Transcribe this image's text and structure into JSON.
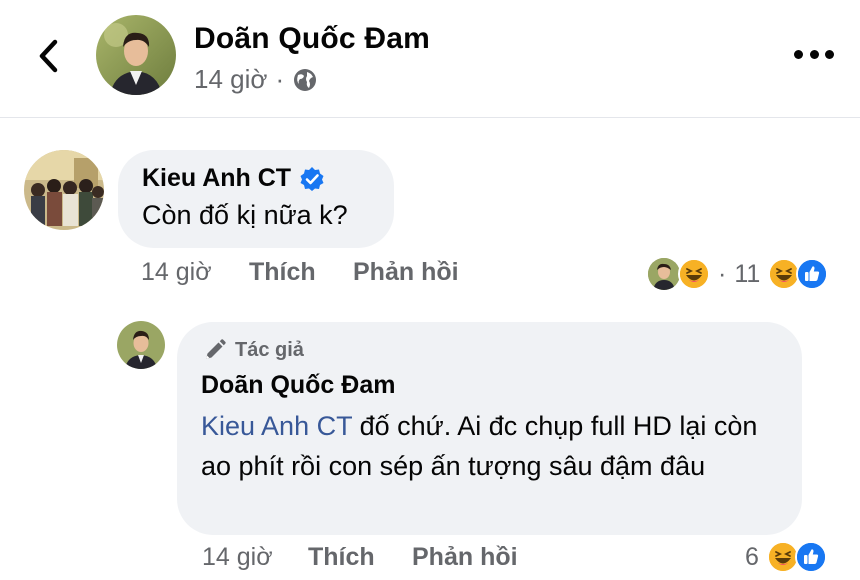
{
  "header": {
    "name": "Doãn Quốc Đam",
    "time": "14 giờ",
    "separator": "·"
  },
  "comments": [
    {
      "author": "Kieu Anh CT",
      "verified": true,
      "text": "Còn đố kị nữa k?",
      "time": "14 giờ",
      "like_label": "Thích",
      "reply_label": "Phản hồi",
      "reaction_separator": "·",
      "reaction_count": "11"
    },
    {
      "author_badge": "Tác giả",
      "author": "Doãn Quốc Đam",
      "mention": "Kieu Anh CT",
      "text": " đố chứ. Ai đc chụp full HD lại còn ao phít rồi con sép ấn tượng sâu đậm đâu",
      "time": "14 giờ",
      "like_label": "Thích",
      "reply_label": "Phản hồi",
      "reaction_count": "6"
    }
  ],
  "colors": {
    "verified": "#1877f2",
    "like": "#1877f2",
    "haha": "#f7b125",
    "mention": "#385898",
    "bubble": "#f0f2f5",
    "secondary_text": "#65676b"
  },
  "icons": [
    "back-arrow-icon",
    "globe-icon",
    "more-icon",
    "verified-badge-icon",
    "pen-icon",
    "haha-icon",
    "like-icon"
  ]
}
